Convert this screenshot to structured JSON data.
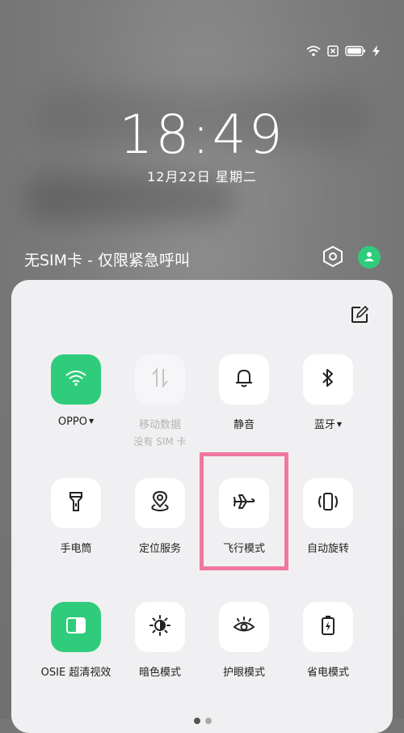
{
  "status_bar": {
    "icons": [
      "wifi-icon",
      "no-sim-icon",
      "battery-icon",
      "charging-icon"
    ]
  },
  "clock": {
    "time": "18:49",
    "date": "12月22日 星期二"
  },
  "header": {
    "sim_status": "无SIM卡 - 仅限紧急呼叫",
    "settings_icon": "settings-icon",
    "avatar_icon": "user-icon"
  },
  "colors": {
    "accent": "#2fcc7b",
    "highlight": "#f0789e"
  },
  "tiles": [
    {
      "label": "OPPO",
      "sub": "",
      "state": "on",
      "icon": "wifi-icon",
      "dropdown": true
    },
    {
      "label": "移动数据",
      "sub": "没有 SIM 卡",
      "state": "disabled",
      "icon": "mobile-data-icon",
      "dropdown": false
    },
    {
      "label": "静音",
      "sub": "",
      "state": "off",
      "icon": "bell-icon",
      "dropdown": false
    },
    {
      "label": "蓝牙",
      "sub": "",
      "state": "off",
      "icon": "bluetooth-icon",
      "dropdown": true
    },
    {
      "label": "手电筒",
      "sub": "",
      "state": "off",
      "icon": "flashlight-icon",
      "dropdown": false
    },
    {
      "label": "定位服务",
      "sub": "",
      "state": "off",
      "icon": "location-icon",
      "dropdown": false
    },
    {
      "label": "飞行模式",
      "sub": "",
      "state": "off",
      "icon": "airplane-icon",
      "dropdown": false
    },
    {
      "label": "自动旋转",
      "sub": "",
      "state": "off",
      "icon": "auto-rotate-icon",
      "dropdown": false
    },
    {
      "label": "OSIE 超清视效",
      "sub": "",
      "state": "on",
      "icon": "osie-icon",
      "dropdown": false
    },
    {
      "label": "暗色模式",
      "sub": "",
      "state": "off",
      "icon": "dark-mode-icon",
      "dropdown": false
    },
    {
      "label": "护眼模式",
      "sub": "",
      "state": "off",
      "icon": "eye-icon",
      "dropdown": false
    },
    {
      "label": "省电模式",
      "sub": "",
      "state": "off",
      "icon": "battery-saver-icon",
      "dropdown": false
    }
  ]
}
